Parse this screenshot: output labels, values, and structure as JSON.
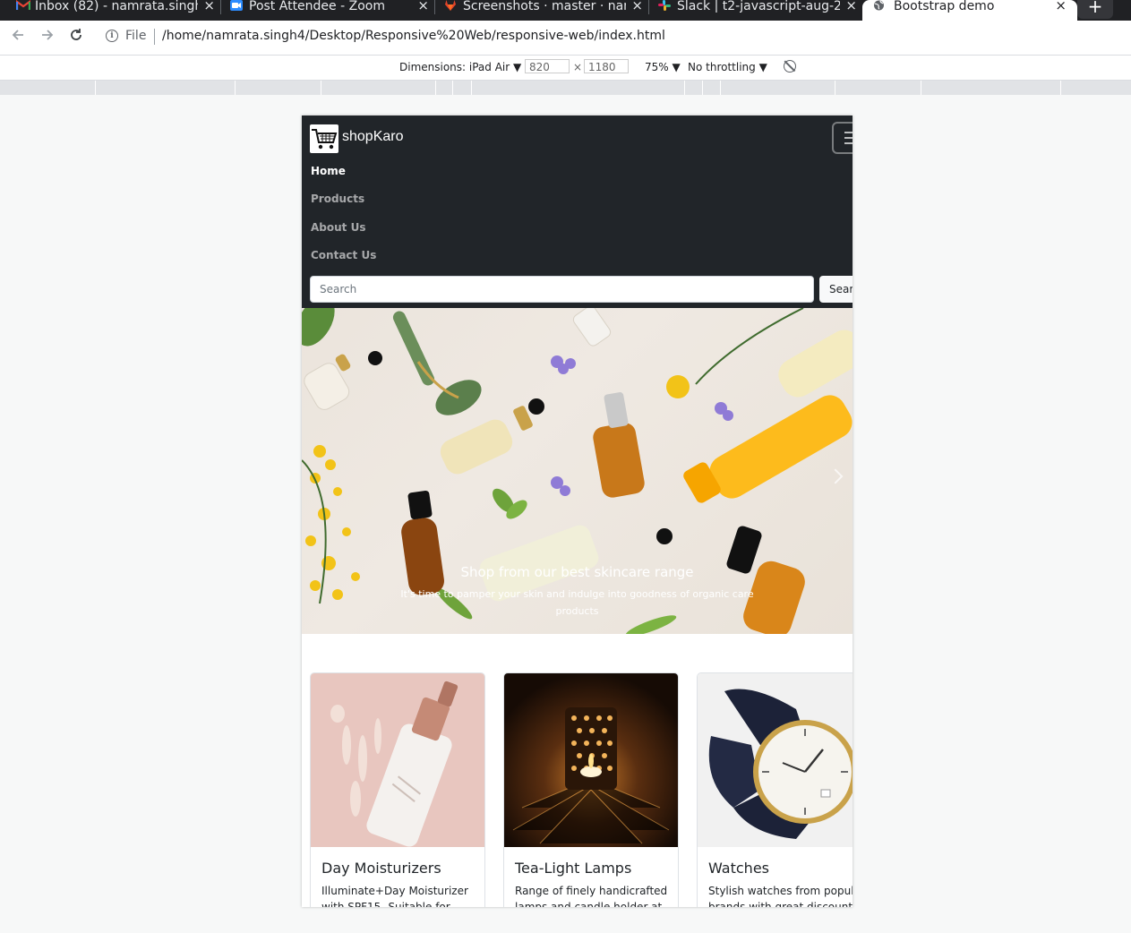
{
  "browser": {
    "tabs": [
      {
        "label": "Inbox (82) - namrata.singh",
        "icon_color": "#ea4335",
        "icon": "gmail-icon"
      },
      {
        "label": "Post Attendee - Zoom",
        "icon_color": "#2d8cff",
        "icon": "zoom-icon"
      },
      {
        "label": "Screenshots · master · nam",
        "icon_color": "#e24329",
        "icon": "gitlab-icon"
      },
      {
        "label": "Slack | t2-javascript-aug-2",
        "icon_color": "#e01e5a",
        "icon": "slack-icon"
      },
      {
        "label": "Bootstrap demo",
        "icon_color": "#5f6368",
        "icon": "globe-icon"
      }
    ],
    "new_tab": "+",
    "close_glyph": "×",
    "address": {
      "scheme_label": "File",
      "url": "/home/namrata.singh4/Desktop/Responsive%20Web/responsive-web/index.html"
    },
    "devtools": {
      "dimensions_label": "Dimensions: iPad Air ▼",
      "width": "820",
      "height": "1180",
      "times": "×",
      "zoom": "75% ▼",
      "throttling": "No throttling ▼"
    }
  },
  "site": {
    "brand": "shopKaro",
    "nav": [
      "Home",
      "Products",
      "About Us",
      "Contact Us"
    ],
    "search_placeholder": "Search",
    "search_button": "Sear",
    "hero": {
      "title": "Shop from our best skincare range",
      "text": "It's time to pamper your skin and indulge into goodness of organic care products"
    },
    "cards": [
      {
        "title": "Day Moisturizers",
        "text": "Illuminate+Day Moisturizer with SPF15- Suitable for"
      },
      {
        "title": "Tea-Light Lamps",
        "text": "Range of finely handicrafted lamps and candle holder at"
      },
      {
        "title": "Watches",
        "text": "Stylish watches from popular brands with great discount"
      }
    ]
  }
}
